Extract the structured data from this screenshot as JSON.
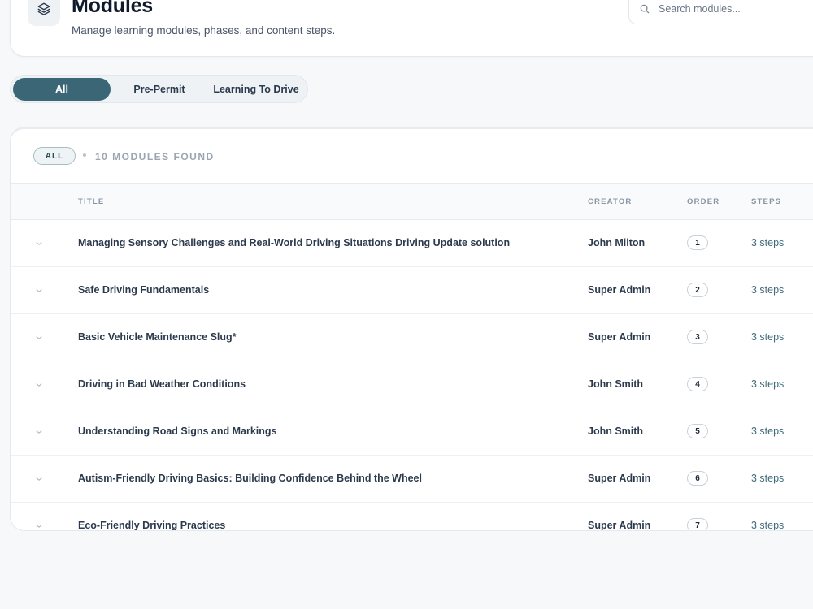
{
  "header": {
    "title": "Modules",
    "subtitle": "Manage learning modules, phases, and content steps.",
    "icon": "layers-icon",
    "search": {
      "placeholder": "Search modules...",
      "value": ""
    }
  },
  "tabs": [
    {
      "label": "All",
      "active": true
    },
    {
      "label": "Pre-Permit",
      "active": false
    },
    {
      "label": "Learning To Drive",
      "active": false
    }
  ],
  "summary": {
    "filter_badge": "ALL",
    "found_text": "10 MODULES FOUND"
  },
  "table": {
    "columns": {
      "title": "TITLE",
      "creator": "CREATOR",
      "order": "ORDER",
      "steps": "STEPS"
    },
    "rows": [
      {
        "title": "Managing Sensory Challenges and Real-World Driving Situations Driving Update solution",
        "creator": "John Milton",
        "order": "1",
        "steps": "3 steps"
      },
      {
        "title": "Safe Driving Fundamentals",
        "creator": "Super Admin",
        "order": "2",
        "steps": "3 steps"
      },
      {
        "title": "Basic Vehicle Maintenance Slug*",
        "creator": "Super Admin",
        "order": "3",
        "steps": "3 steps"
      },
      {
        "title": "Driving in Bad Weather Conditions",
        "creator": "John Smith",
        "order": "4",
        "steps": "3 steps"
      },
      {
        "title": "Understanding Road Signs and Markings",
        "creator": "John Smith",
        "order": "5",
        "steps": "3 steps"
      },
      {
        "title": "Autism-Friendly Driving Basics: Building Confidence Behind the Wheel",
        "creator": "Super Admin",
        "order": "6",
        "steps": "3 steps"
      },
      {
        "title": "Eco-Friendly Driving Practices",
        "creator": "Super Admin",
        "order": "7",
        "steps": "3 steps"
      }
    ]
  },
  "colors": {
    "accent": "#3b6676",
    "background": "#f6f8fa",
    "steps_text": "#3f6b7a"
  }
}
